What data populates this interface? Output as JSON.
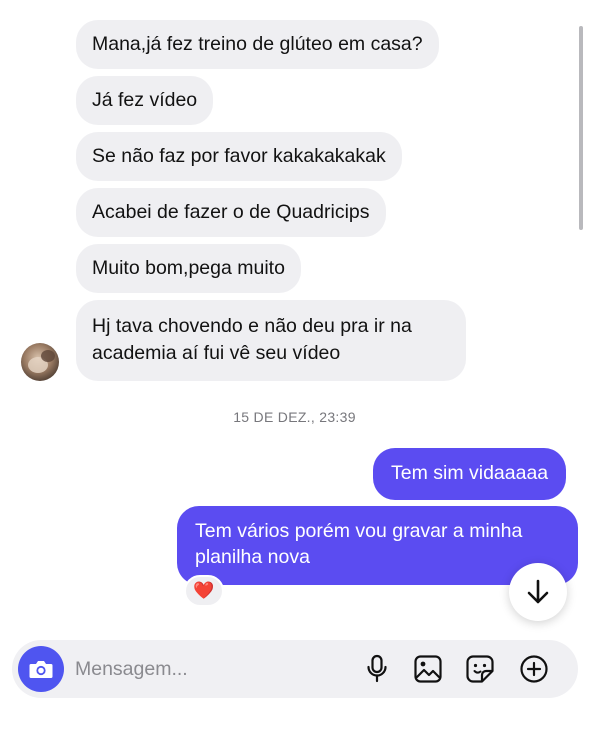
{
  "incoming_messages": [
    "Mana,já fez treino de glúteo em casa?",
    "Já fez vídeo",
    "Se não faz por favor kakakakakak",
    "Acabei de fazer o de Quadricips",
    "Muito bom,pega muito",
    "Hj tava chovendo e não deu pra ir na academia aí fui vê seu vídeo"
  ],
  "timestamp": "15 DE DEZ., 23:39",
  "outgoing_messages": [
    "Tem sim vidaaaaa",
    "Tem vários porém vou gravar a minha planilha nova"
  ],
  "reaction": {
    "emoji": "❤️",
    "icon": "heart-icon"
  },
  "composer": {
    "placeholder": "Mensagem...",
    "icons": [
      "camera-icon",
      "microphone-icon",
      "gallery-icon",
      "sticker-icon",
      "plus-circle-icon"
    ]
  },
  "colors": {
    "outgoing_bubble": "#5b4cf1",
    "incoming_bubble": "#efeff2",
    "camera_button": "#4f55f0",
    "heart": "#ee2a3c"
  }
}
